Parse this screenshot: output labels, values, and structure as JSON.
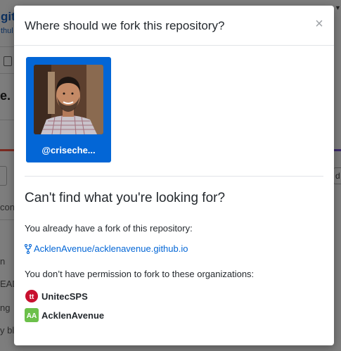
{
  "background": {
    "title_fragment": "git",
    "sub_fragment": "thul",
    "dot_fragment": "e.",
    "right_button_fragment": "d",
    "left_fragments": [
      "con",
      "n",
      "EAD",
      "ng",
      "y bl"
    ]
  },
  "modal": {
    "title": "Where should we fork this repository?",
    "close_glyph": "×",
    "account": {
      "name": "@criseche..."
    },
    "section_title": "Can't find what you're looking for?",
    "existing_fork_text": "You already have a fork of this repository:",
    "existing_fork_link": "AcklenAvenue/acklenavenue.github.io",
    "no_permission_text": "You don’t have permission to fork to these organizations:",
    "organizations": [
      {
        "name": "UnitecSPS",
        "logo_text": "tt",
        "logo_color": "#c8102e",
        "icon": "unitec-logo-icon"
      },
      {
        "name": "AcklenAvenue",
        "logo_text": "AA",
        "logo_color": "#6cc04a",
        "icon": "acklen-logo-icon"
      }
    ]
  },
  "colors": {
    "accent": "#0366d6",
    "overlay": "#7f7f7f"
  }
}
